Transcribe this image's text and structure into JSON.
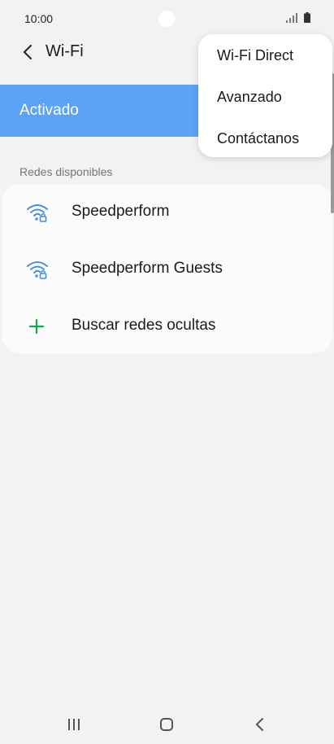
{
  "status_bar": {
    "time": "10:00"
  },
  "header": {
    "title": "Wi-Fi"
  },
  "toggle": {
    "label": "Activado",
    "accent_color": "#5ea2f5"
  },
  "available_networks": {
    "section_title": "Redes disponibles",
    "items": [
      {
        "name": "Speedperform",
        "icon": "wifi-lock-icon"
      },
      {
        "name": "Speedperform Guests",
        "icon": "wifi-lock-icon"
      },
      {
        "name": "Buscar redes ocultas",
        "icon": "plus-icon"
      }
    ]
  },
  "overflow_menu": {
    "items": [
      {
        "label": "Wi-Fi Direct"
      },
      {
        "label": "Avanzado"
      },
      {
        "label": "Contáctanos"
      }
    ]
  }
}
